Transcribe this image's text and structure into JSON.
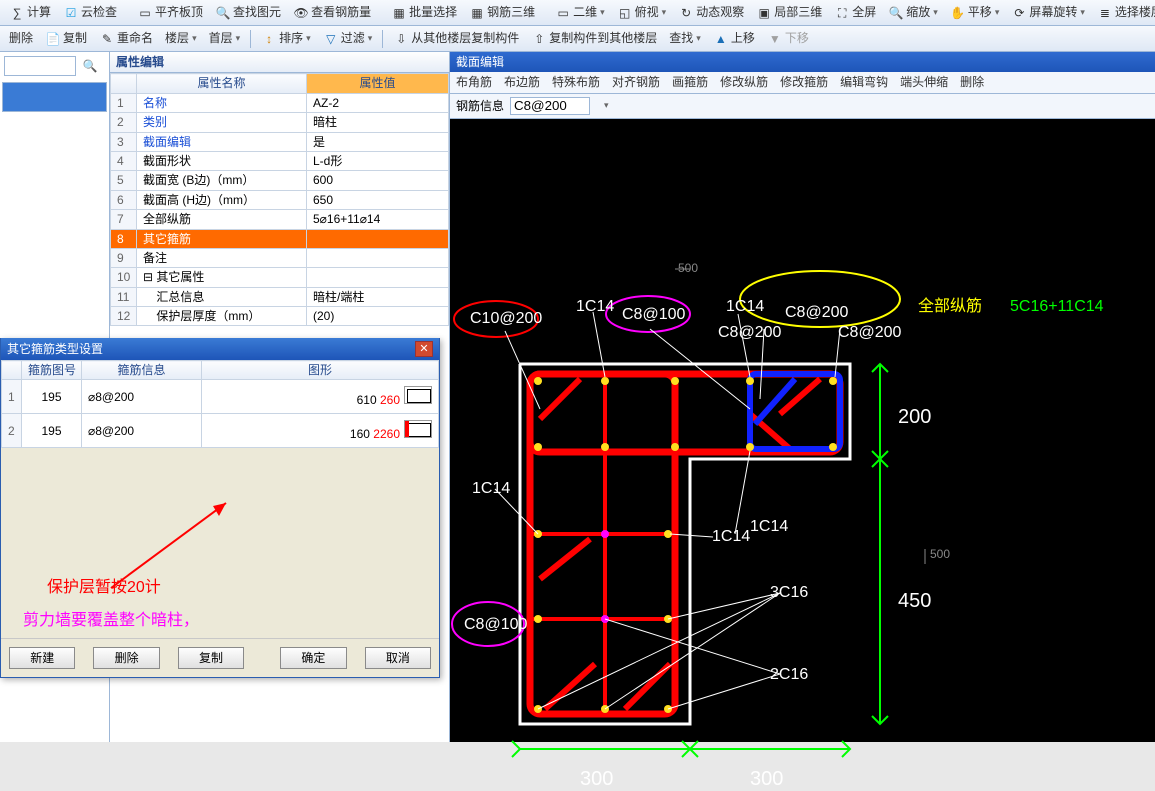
{
  "toolbar1": {
    "items": [
      "计算",
      "云检查",
      "平齐板顶",
      "查找图元",
      "查看钢筋量",
      "批量选择",
      "钢筋三维"
    ],
    "view_combo": "二维",
    "items2": [
      "俯视",
      "动态观察",
      "局部三维",
      "全屏",
      "缩放",
      "平移",
      "屏幕旋转",
      "选择楼层"
    ]
  },
  "toolbar2": {
    "items": [
      "删除",
      "复制",
      "重命名",
      "楼层",
      "首层"
    ],
    "sort": "排序",
    "filter": "过滤",
    "copyfrom": "从其他楼层复制构件",
    "copyto": "复制构件到其他楼层",
    "find": "查找",
    "up": "上移",
    "down": "下移"
  },
  "leftpane": {
    "search_placeholder": ""
  },
  "prop_panel": {
    "title": "属性编辑",
    "headers": {
      "name": "属性名称",
      "value": "属性值"
    },
    "rows": [
      {
        "n": "1",
        "name": "名称",
        "value": "AZ-2",
        "link": true
      },
      {
        "n": "2",
        "name": "类别",
        "value": "暗柱",
        "link": true
      },
      {
        "n": "3",
        "name": "截面编辑",
        "value": "是",
        "link": true
      },
      {
        "n": "4",
        "name": "截面形状",
        "value": "L-d形"
      },
      {
        "n": "5",
        "name": "截面宽 (B边)（mm）",
        "value": "600"
      },
      {
        "n": "6",
        "name": "截面高 (H边)（mm）",
        "value": "650"
      },
      {
        "n": "7",
        "name": "全部纵筋",
        "value": "5⌀16+11⌀14"
      },
      {
        "n": "8",
        "name": "其它箍筋",
        "value": "",
        "sel": true
      },
      {
        "n": "9",
        "name": "备注",
        "value": ""
      },
      {
        "n": "10",
        "name": "其它属性",
        "value": "",
        "expand": true
      },
      {
        "n": "11",
        "name": "汇总信息",
        "value": "暗柱/端柱",
        "indent": true
      },
      {
        "n": "12",
        "name": "保护层厚度（mm）",
        "value": "(20)",
        "indent": true
      }
    ]
  },
  "dlg": {
    "title": "其它箍筋类型设置",
    "headers": {
      "no": "箍筋图号",
      "info": "箍筋信息",
      "shape": "图形"
    },
    "rows": [
      {
        "n": "1",
        "no": "195",
        "info": "⌀8@200",
        "w": "610",
        "h": "260"
      },
      {
        "n": "2",
        "no": "195",
        "info": "⌀8@200",
        "w": "160",
        "h": "2260"
      }
    ],
    "buttons": {
      "new": "新建",
      "del": "删除",
      "copy": "复制",
      "ok": "确定",
      "cancel": "取消"
    },
    "note1": "保护层暂按20计",
    "note2": "剪力墙要覆盖整个暗柱，"
  },
  "section_panel": {
    "title": "截面编辑",
    "tools": [
      "布角筋",
      "布边筋",
      "特殊布筋",
      "对齐钢筋",
      "画箍筋",
      "修改纵筋",
      "修改箍筋",
      "编辑弯钩",
      "端头伸缩",
      "删除"
    ],
    "sublabel": "钢筋信息",
    "subvalue": "C8@200",
    "labels": {
      "c10_200": "C10@200",
      "c8_100a": "C8@100",
      "c8_100b": "C8@100",
      "c8_200a": "C8@200",
      "c8_200b": "C8@200",
      "c8_200c": "C8@200",
      "c14a": "1C14",
      "c14b": "1C14",
      "c14c": "1C14",
      "c14d": "1C14",
      "c14e": "1C14",
      "c14f": "1C14",
      "c16a": "3C16",
      "c16b": "2C16",
      "all_label": "全部纵筋",
      "all_val": "5C16+11C14",
      "d300a": "300",
      "d300b": "300",
      "d200": "200",
      "d450": "450",
      "r500a": "500",
      "r500b": "500"
    }
  }
}
